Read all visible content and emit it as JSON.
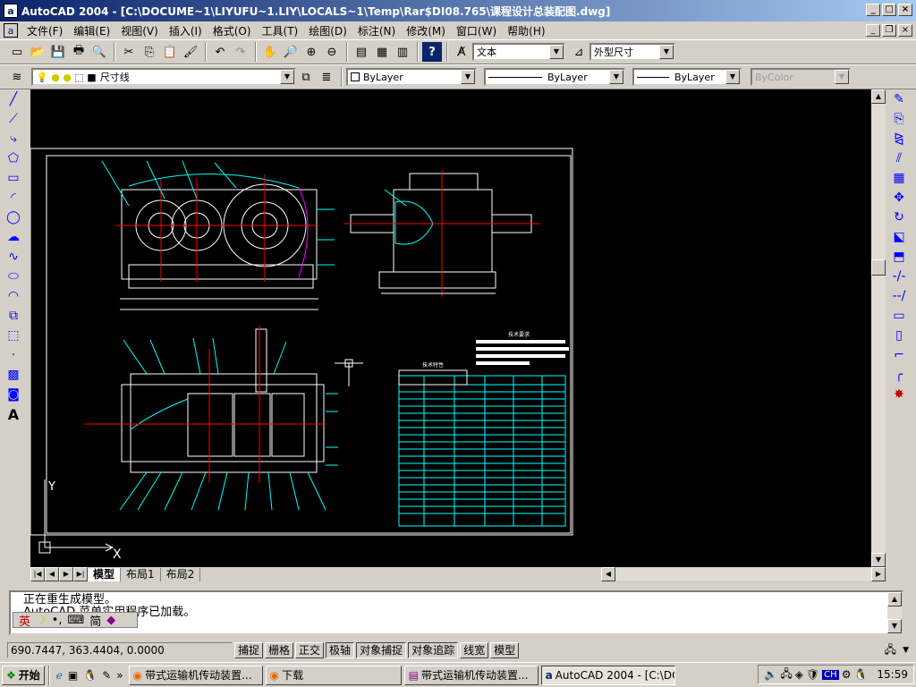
{
  "window": {
    "title": "AutoCAD 2004 - [C:\\DOCUME~1\\LIYUFU~1.LIY\\LOCALS~1\\Temp\\Rar$DI08.765\\课程设计总装配图.dwg]",
    "app_icon": "a"
  },
  "menu": [
    "文件(F)",
    "编辑(E)",
    "视图(V)",
    "插入(I)",
    "格式(O)",
    "工具(T)",
    "绘图(D)",
    "标注(N)",
    "修改(M)",
    "窗口(W)",
    "帮助(H)"
  ],
  "toolbar1": {
    "text_style": "文本",
    "dim_style": "外型尺寸"
  },
  "toolbar2": {
    "layer": "尺寸线",
    "color": "ByLayer",
    "linetype": "ByLayer",
    "lineweight": "ByLayer",
    "plotstyle": "ByColor"
  },
  "ucs": {
    "x_label": "X",
    "y_label": "Y"
  },
  "tabs": [
    "模型",
    "布局1",
    "布局2"
  ],
  "command_lines": [
    "正在重生成模型。",
    "AutoCAD 菜单实用程序已加载。"
  ],
  "ime": {
    "lang": "英",
    "mode": "简"
  },
  "status": {
    "coords": "690.7447, 363.4404, 0.0000",
    "toggles": [
      "捕捉",
      "栅格",
      "正交",
      "极轴",
      "对象捕捉",
      "对象追踪",
      "线宽",
      "模型"
    ]
  },
  "taskbar": {
    "start": "开始",
    "tasks": [
      "带式运输机传动装置...",
      "下载",
      "带式运输机传动装置...",
      "AutoCAD 2004 - [C:\\DO..."
    ],
    "tray_ch": "CH",
    "clock": "15:59"
  },
  "drawing": {
    "table_title_top": "技术要求",
    "table_title_left": "技术特性"
  }
}
